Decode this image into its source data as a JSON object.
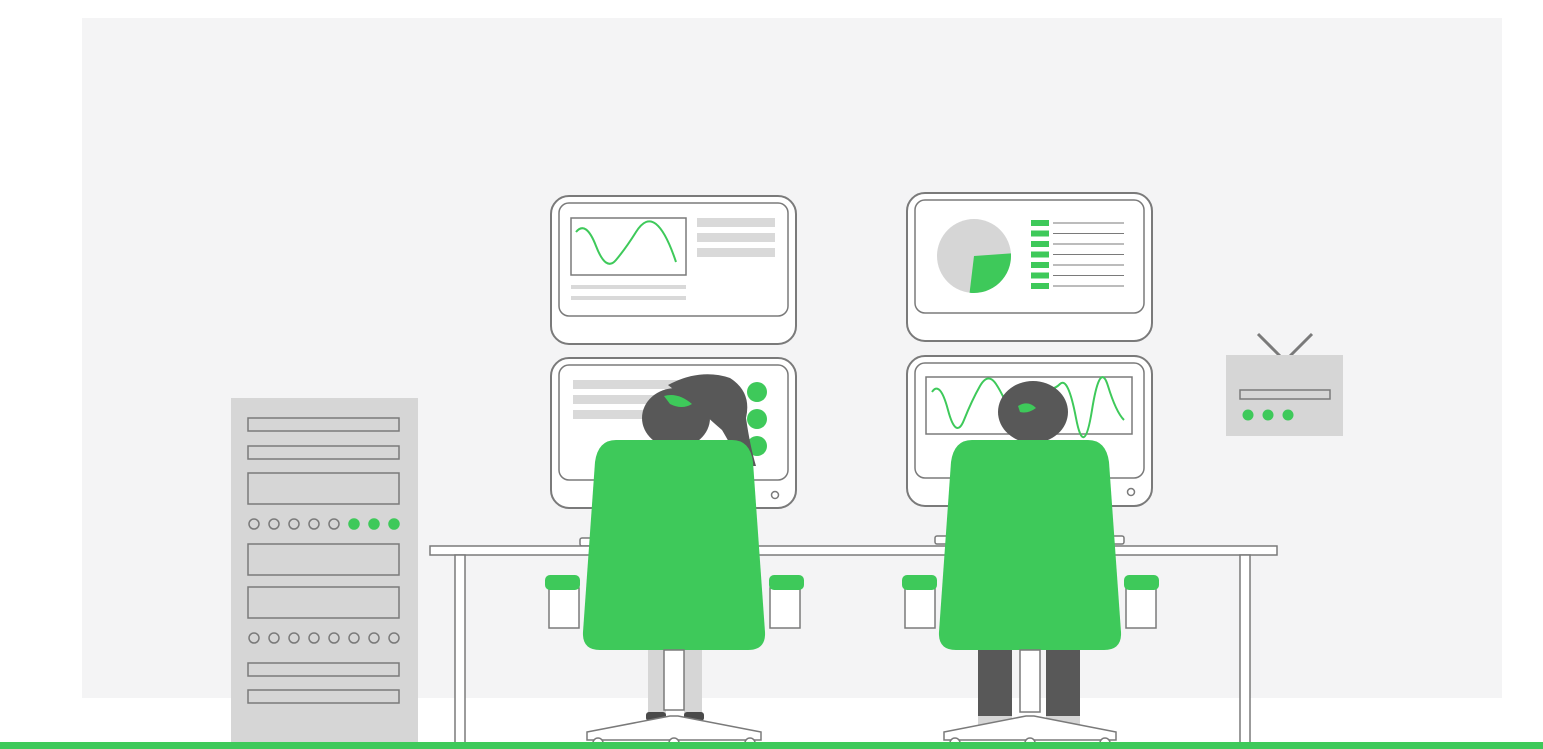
{
  "colors": {
    "page": "#ffffff",
    "backdrop": "#f4f4f5",
    "accent": "#3ec95a",
    "accent_dark": "#2fae49",
    "outline": "#7a7a7a",
    "panel": "#d6d6d6",
    "line_gray": "#d9d9d9",
    "hair": "#585858",
    "skin_shadow": "#4a4a4a",
    "chair_base": "#ffffff"
  },
  "illustration": {
    "subject": "monitoring-operators-scene",
    "icons": [
      "server-rack-icon",
      "wall-router-icon",
      "wave-chart-icon",
      "pie-chart-icon",
      "office-chair-icon",
      "operator-person-icon"
    ],
    "server_rack": {
      "indicator_rows": [
        {
          "total": 8,
          "lit": 3
        },
        {
          "total": 8,
          "lit": 0
        }
      ]
    },
    "router": {
      "indicator_lights": 3
    },
    "pie_chart": {
      "highlighted_share": 0.28
    },
    "legend_bars": 7
  }
}
